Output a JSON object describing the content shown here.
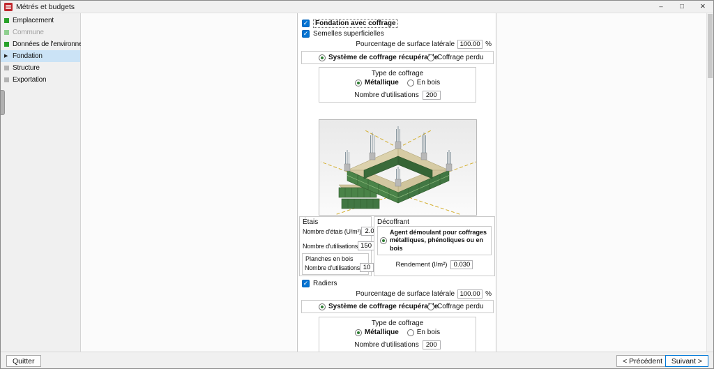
{
  "colors": {
    "accent_blue": "#0078d7",
    "checkbox_blue": "#0473d2",
    "step_green": "#2aa12a",
    "radio_dot_green": "#2e7d32",
    "sidebar_highlight": "#cbe3f6",
    "app_icon_red": "#c0272d"
  },
  "icons": {
    "check": "✓",
    "minimize": "–",
    "maximize": "□",
    "close": "✕",
    "arrow_right": "▶"
  },
  "window": {
    "title": "Métrés et budgets"
  },
  "sidebar": {
    "items": [
      {
        "label": "Emplacement"
      },
      {
        "label": "Commune"
      },
      {
        "label": "Données de l'environnement"
      },
      {
        "label": "Fondation"
      },
      {
        "label": "Structure"
      },
      {
        "label": "Exportation"
      }
    ]
  },
  "form": {
    "header_checkbox": "Fondation avec coffrage",
    "semelles": {
      "checkbox": "Semelles superficielles",
      "pct_label": "Pourcentage de surface latérale",
      "pct_value": "100.00",
      "pct_unit": "%",
      "system": {
        "recuperable": "Système de coffrage récupérable",
        "perdu": "Coffrage perdu"
      },
      "type": {
        "title": "Type de coffrage",
        "metallique": "Métallique",
        "bois": "En bois",
        "uses_label": "Nombre d'utilisations",
        "uses_value": "200"
      }
    },
    "etais": {
      "title": "Étais",
      "count_label": "Nombre d'étais (U/m²)",
      "count_value": "2.0",
      "uses_label": "Nombre d'utilisations",
      "uses_value": "150",
      "planches": {
        "title": "Planches en bois",
        "uses_label": "Nombre d'utilisations",
        "uses_value": "10"
      }
    },
    "decoffrant": {
      "title": "Décoffrant",
      "agent": "Agent démoulant pour coffrages métalliques, phénoliques ou en bois",
      "rendement_label": "Rendement (l/m²)",
      "rendement_value": "0.030"
    },
    "radiers": {
      "checkbox": "Radiers",
      "pct_label": "Pourcentage de surface latérale",
      "pct_value": "100.00",
      "pct_unit": "%",
      "system": {
        "recuperable": "Système de coffrage récupérable",
        "perdu": "Coffrage perdu"
      },
      "type": {
        "title": "Type de coffrage",
        "metallique": "Métallique",
        "bois": "En bois",
        "uses_label": "Nombre d'utilisations",
        "uses_value": "200"
      }
    }
  },
  "footer": {
    "quit": "Quitter",
    "previous": "< Précédent",
    "next": "Suivant >"
  }
}
